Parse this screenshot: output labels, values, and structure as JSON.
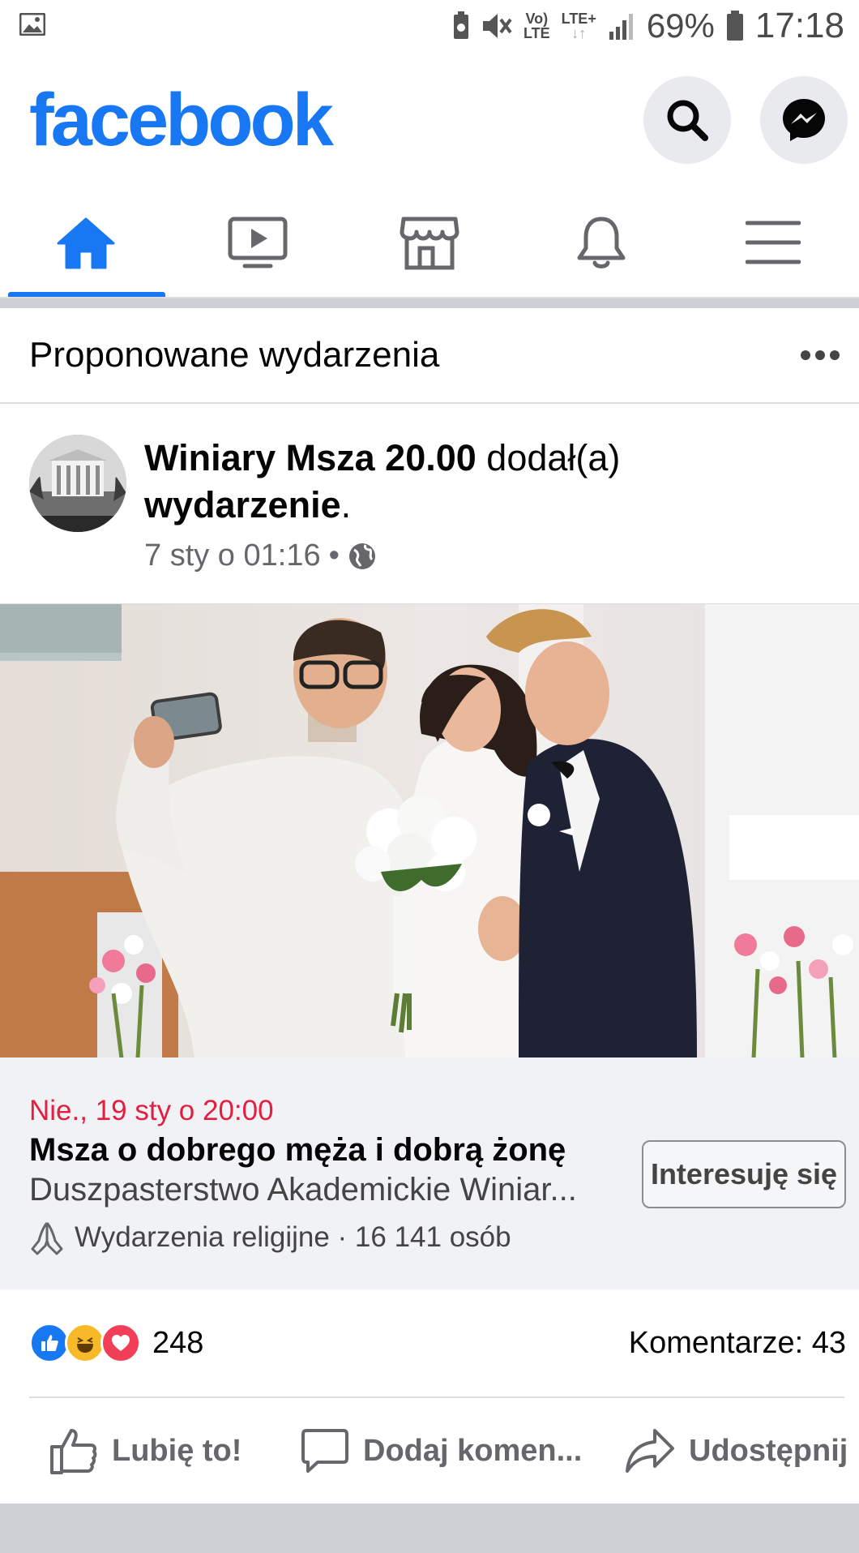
{
  "status_bar": {
    "network_top": "Vo)",
    "network_bottom": "LTE",
    "lte_plus": "LTE+",
    "battery": "69%",
    "time": "17:18"
  },
  "header": {
    "logo": "facebook",
    "icons": [
      "search-icon",
      "messenger-icon"
    ]
  },
  "nav": {
    "tabs": [
      "home-icon",
      "watch-icon",
      "marketplace-icon",
      "notifications-icon",
      "menu-icon"
    ],
    "active": 0
  },
  "section": {
    "title": "Proponowane wydarzenia"
  },
  "post": {
    "author": "Winiary Msza 20.00",
    "action_text": " dodał(a) ",
    "object": "wydarzenie",
    "period": ".",
    "time": "7 sty o 01:16",
    "dot": "•"
  },
  "event": {
    "date": "Nie., 19 sty o 20:00",
    "title": "Msza o dobrego męża i dobrą żonę",
    "organizer": "Duszpasterstwo Akademickie Winiar...",
    "category": "Wydarzenia religijne · 16 141 osób",
    "interest_button": "Interesuję się"
  },
  "reactions": {
    "count": "248",
    "comments": "Komentarze: 43",
    "colors": {
      "like": "#1877f2",
      "haha": "#f7b928",
      "love": "#f33e58"
    }
  },
  "actions": {
    "like": "Lubię to!",
    "comment": "Dodaj komen...",
    "share": "Udostępnij"
  }
}
